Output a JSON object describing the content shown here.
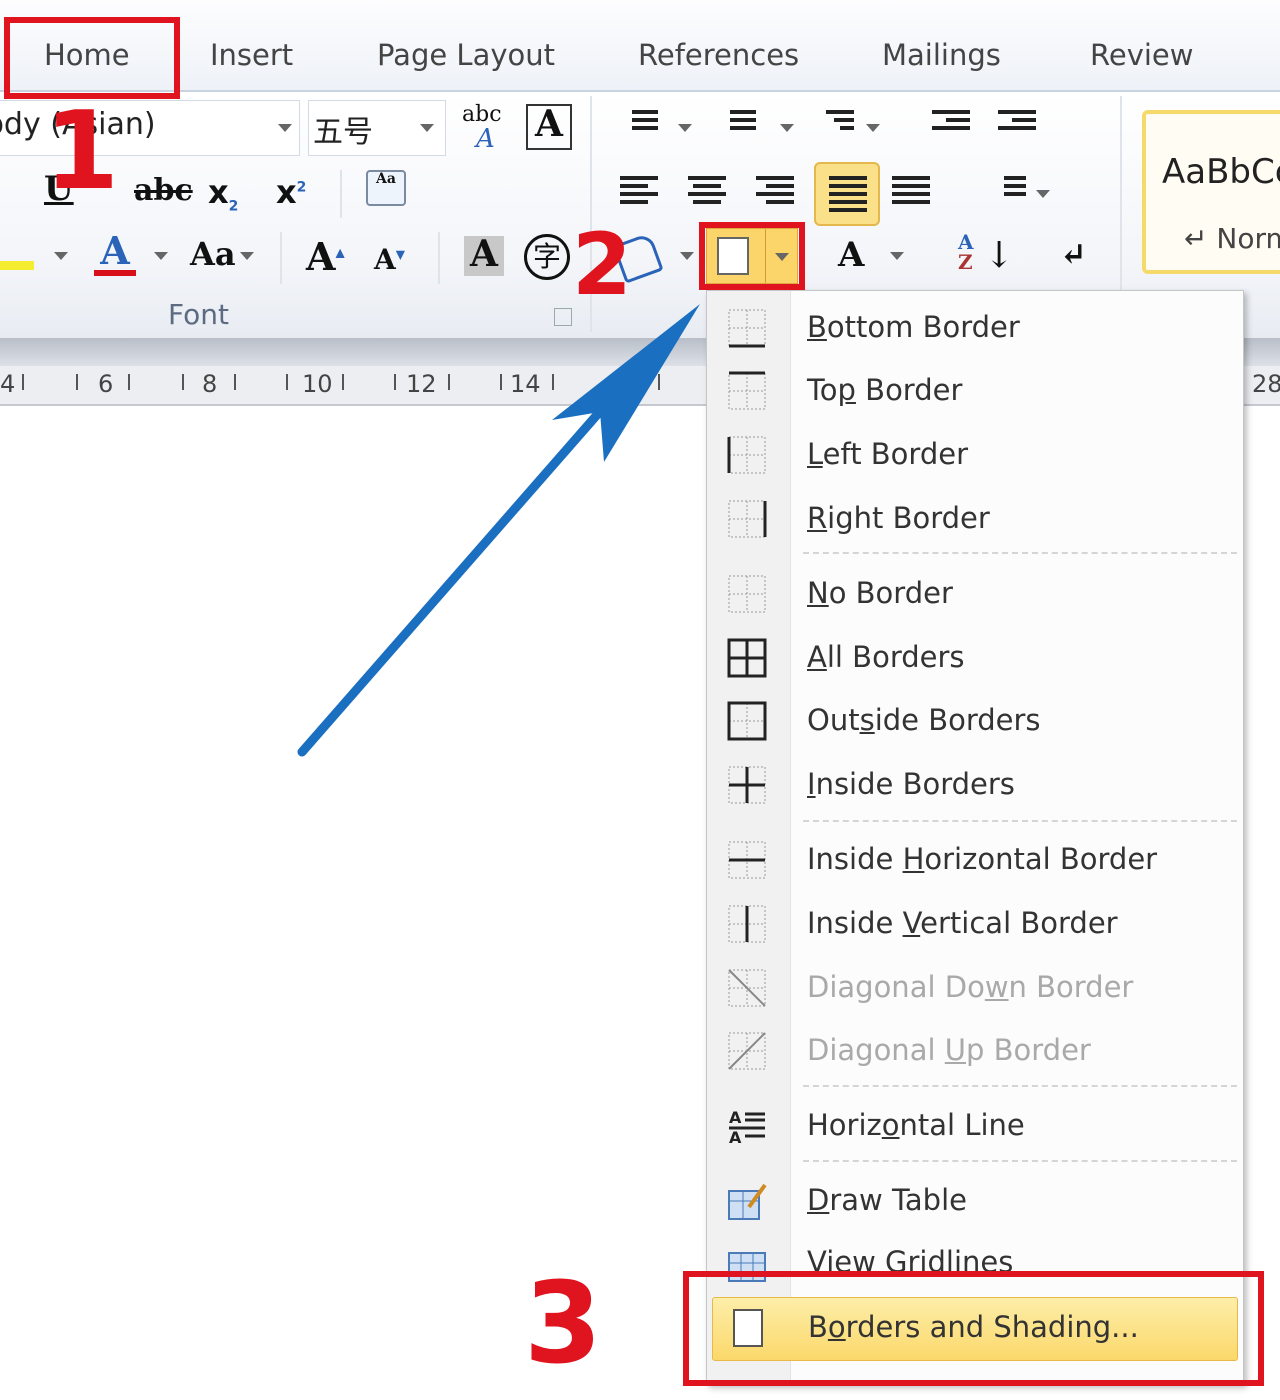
{
  "tabs": [
    "Home",
    "Insert",
    "Page Layout",
    "References",
    "Mailings",
    "Review"
  ],
  "font_group": {
    "font_name": "Body (Asian)",
    "font_size": "五号",
    "group_label": "Font",
    "strike_label": "abc",
    "case_label": "Aa",
    "enclose_char": "字"
  },
  "styles": {
    "preview": "AaBbCc",
    "name": "Normal"
  },
  "ruler": {
    "labels": [
      "4",
      "6",
      "8",
      "10",
      "12",
      "14",
      "28"
    ]
  },
  "borders_menu": {
    "items": [
      {
        "label": "Bottom Border",
        "key": 0,
        "icon": "bottom-border-icon"
      },
      {
        "label": "Top Border",
        "key": 2,
        "icon": "top-border-icon"
      },
      {
        "label": "Left Border",
        "key": 0,
        "icon": "left-border-icon"
      },
      {
        "label": "Right Border",
        "key": 0,
        "icon": "right-border-icon",
        "sep": true
      },
      {
        "label": "No Border",
        "key": 0,
        "icon": "no-border-icon"
      },
      {
        "label": "All Borders",
        "key": 0,
        "icon": "all-borders-icon"
      },
      {
        "label": "Outside Borders",
        "key": 3,
        "icon": "outside-borders-icon"
      },
      {
        "label": "Inside Borders",
        "key": 0,
        "icon": "inside-borders-icon",
        "sep": true
      },
      {
        "label": "Inside Horizontal Border",
        "key": 7,
        "icon": "inside-horizontal-border-icon"
      },
      {
        "label": "Inside Vertical Border",
        "key": 7,
        "icon": "inside-vertical-border-icon"
      },
      {
        "label": "Diagonal Down Border",
        "key": 11,
        "icon": "diagonal-down-border-icon",
        "disabled": true
      },
      {
        "label": "Diagonal Up Border",
        "key": 9,
        "icon": "diagonal-up-border-icon",
        "disabled": true,
        "sep": true
      },
      {
        "label": "Horizontal Line",
        "key": 5,
        "icon": "horizontal-line-icon",
        "sep": true
      },
      {
        "label": "Draw Table",
        "key": 0,
        "icon": "draw-table-icon"
      },
      {
        "label": "View Gridlines",
        "key": -1,
        "icon": "view-gridlines-icon"
      },
      {
        "label": "Borders and Shading...",
        "key": 1,
        "icon": "borders-shading-icon",
        "highlighted": true
      }
    ]
  },
  "annotations": {
    "step1": "1",
    "step2": "2",
    "step3": "3",
    "color": "#e0141e",
    "arrow_color": "#1a6fc0"
  },
  "colors": {
    "highlight": "#fbe08a",
    "accent_red": "#e0141e"
  }
}
